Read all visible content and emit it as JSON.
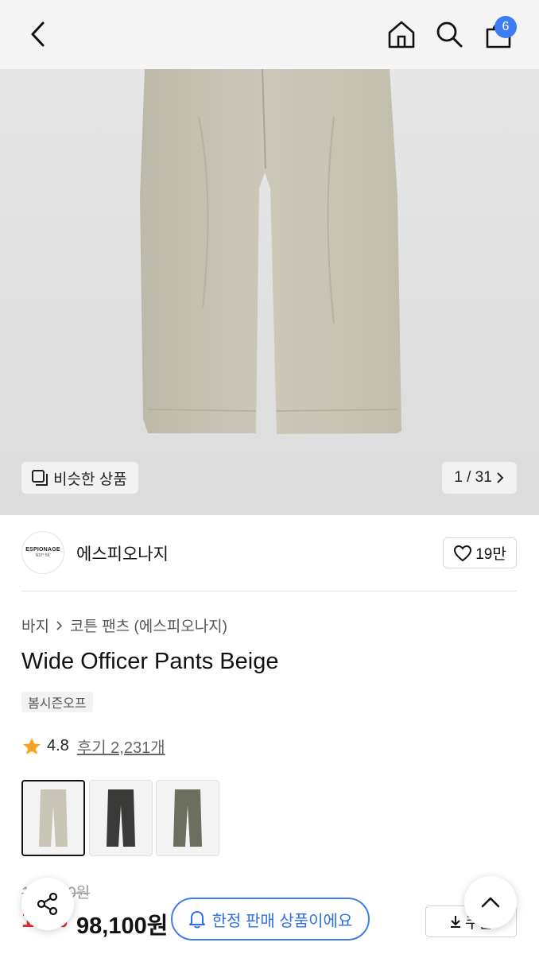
{
  "header": {
    "bag_count": "6"
  },
  "gallery": {
    "similar_label": "비슷한 상품",
    "counter": "1 / 31"
  },
  "brand": {
    "logo_line1": "ESPIONAGE",
    "logo_line2": "N37° 56'",
    "name": "에스피오나지",
    "likes": "19만"
  },
  "breadcrumb": {
    "category": "바지",
    "subcategory": "코튼 팬츠 (에스피오나지)"
  },
  "product": {
    "title": "Wide Officer Pants Beige",
    "season_tag": "봄시즌오프",
    "rating": "4.8",
    "reviews": "후기 2,231개",
    "colors": [
      {
        "name": "beige",
        "hex": "#c9c5b6"
      },
      {
        "name": "black",
        "hex": "#3a3b39"
      },
      {
        "name": "olive",
        "hex": "#6c6e5f"
      }
    ]
  },
  "price": {
    "original": "109,000원",
    "discount": "10%",
    "sale": "98,100원"
  },
  "floating": {
    "limited_label": "한정 판매 상품이에요",
    "coupon_label": "쿠폰"
  },
  "colors": {
    "accent_blue": "#3d7cf2",
    "discount_red": "#f0282e",
    "star": "#f5a524"
  }
}
